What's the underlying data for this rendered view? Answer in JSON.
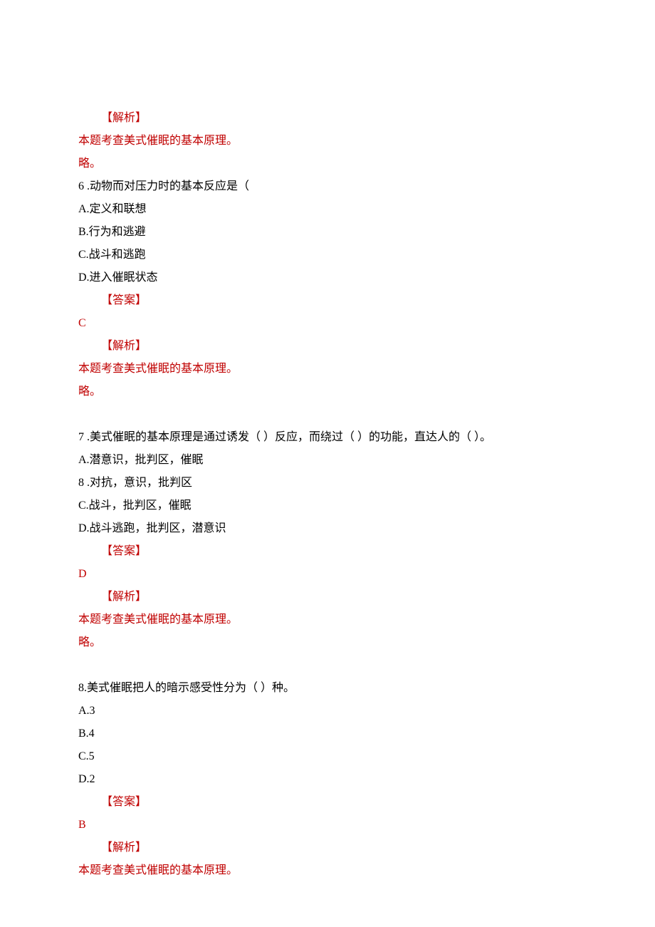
{
  "q5_tail": {
    "analysis_label": "【解析】",
    "analysis_text": "本题考查美式催眠的基本原理。",
    "omit": "略。"
  },
  "q6": {
    "stem": "6  .动物而对压力时的基本反应是（",
    "optA": "A.定义和联想",
    "optB": "B.行为和逃避",
    "optC": "C.战斗和逃跑",
    "optD": "D.进入催眠状态",
    "answer_label": "【答案】",
    "answer": "C",
    "analysis_label": "【解析】",
    "analysis_text": "本题考查美式催眠的基本原理。",
    "omit": "略。"
  },
  "q7": {
    "stem": "7   .美式催眠的基本原理是通过诱发（     ）反应，而绕过（      ）的功能，直达人的（      ）。",
    "optA": "A.潜意识，批判区，催眠",
    "optB_alt": "8   .对抗，意识，批判区",
    "optC": "C.战斗，批判区，催眠",
    "optD": "D.战斗逃跑，批判区，潜意识",
    "answer_label": "【答案】",
    "answer": "D",
    "analysis_label": "【解析】",
    "analysis_text": "本题考查美式催眠的基本原理。",
    "omit": "略。"
  },
  "q8": {
    "stem": "8.美式催眠把人的暗示感受性分为（       ）种。",
    "optA": "A.3",
    "optB": "B.4",
    "optC": "C.5",
    "optD": "D.2",
    "answer_label": "【答案】",
    "answer": "B",
    "analysis_label": "【解析】",
    "analysis_text": "本题考查美式催眠的基本原理。"
  }
}
